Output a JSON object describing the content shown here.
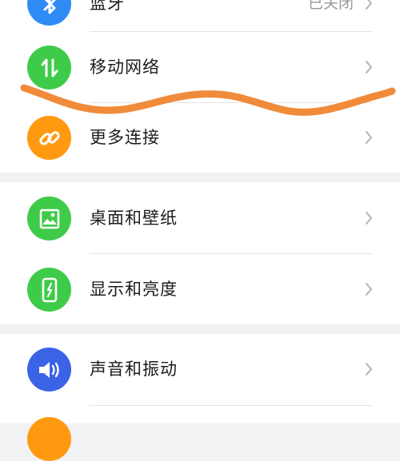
{
  "settings": {
    "rows": [
      {
        "label": "蓝牙",
        "value": "已关闭",
        "icon": "bluetooth-icon",
        "color": "#2f8cf5"
      },
      {
        "label": "移动网络",
        "icon": "mobile-data-icon",
        "color": "#3fcb4a"
      },
      {
        "label": "更多连接",
        "icon": "link-icon",
        "color": "#ff9a10"
      },
      {
        "label": "桌面和壁纸",
        "icon": "wallpaper-icon",
        "color": "#3fcb4a"
      },
      {
        "label": "显示和亮度",
        "icon": "display-brightness-icon",
        "color": "#3fcb4a"
      },
      {
        "label": "声音和振动",
        "icon": "volume-icon",
        "color": "#3b63e6"
      }
    ]
  },
  "annotation": {
    "stroke_color": "#f08b3a"
  }
}
